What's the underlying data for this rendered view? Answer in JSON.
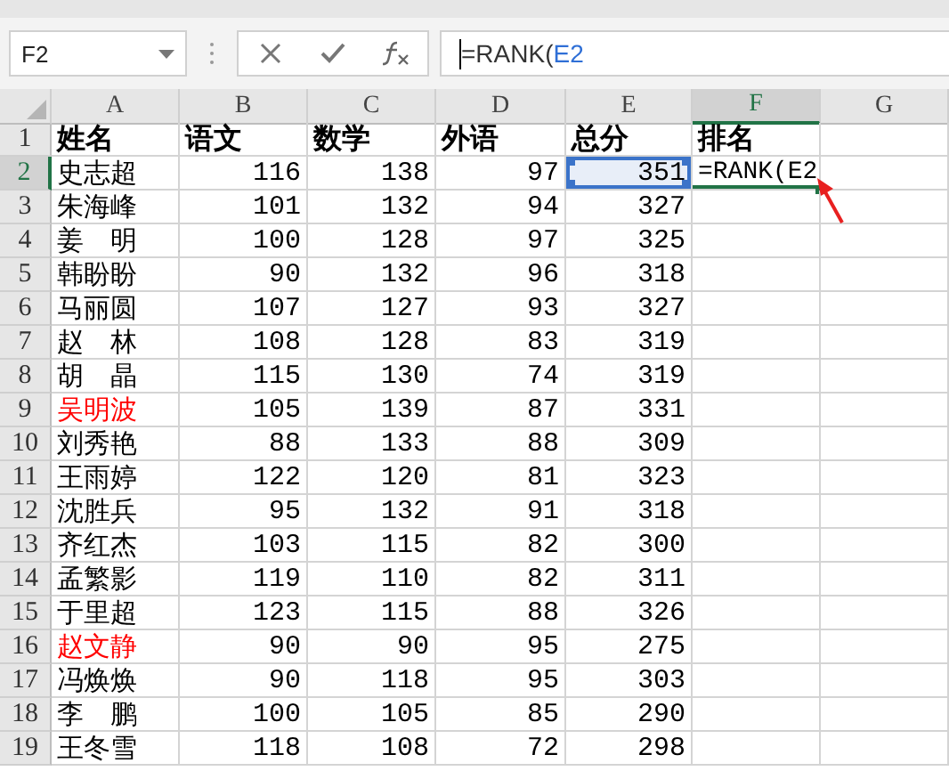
{
  "name_box": "F2",
  "formula": [
    {
      "text": "=RANK(",
      "kind": "plain"
    },
    {
      "text": "E2",
      "kind": "reference"
    }
  ],
  "columns": [
    {
      "label": "A",
      "selected": false
    },
    {
      "label": "B",
      "selected": false
    },
    {
      "label": "C",
      "selected": false
    },
    {
      "label": "D",
      "selected": false
    },
    {
      "label": "E",
      "selected": false
    },
    {
      "label": "F",
      "selected": true
    },
    {
      "label": "G",
      "selected": false
    }
  ],
  "header_row": {
    "number": "1",
    "selected": false,
    "cells": [
      "姓名",
      "语文",
      "数学",
      "外语",
      "总分",
      "排名"
    ]
  },
  "rows": [
    {
      "number": "2",
      "selected": true,
      "name": "史志超",
      "color": "#000000",
      "values": [
        "116",
        "138",
        "97",
        "351"
      ],
      "total_referenced": true,
      "editing": "=RANK(E2"
    },
    {
      "number": "3",
      "selected": false,
      "name": "朱海峰",
      "color": "#000000",
      "values": [
        "101",
        "132",
        "94",
        "327"
      ],
      "total_referenced": false
    },
    {
      "number": "4",
      "selected": false,
      "name": "姜　明",
      "color": "#000000",
      "values": [
        "100",
        "128",
        "97",
        "325"
      ],
      "total_referenced": false
    },
    {
      "number": "5",
      "selected": false,
      "name": "韩盼盼",
      "color": "#000000",
      "values": [
        "90",
        "132",
        "96",
        "318"
      ],
      "total_referenced": false
    },
    {
      "number": "6",
      "selected": false,
      "name": "马丽圆",
      "color": "#000000",
      "values": [
        "107",
        "127",
        "93",
        "327"
      ],
      "total_referenced": false
    },
    {
      "number": "7",
      "selected": false,
      "name": "赵　林",
      "color": "#000000",
      "values": [
        "108",
        "128",
        "83",
        "319"
      ],
      "total_referenced": false
    },
    {
      "number": "8",
      "selected": false,
      "name": "胡　晶",
      "color": "#000000",
      "values": [
        "115",
        "130",
        "74",
        "319"
      ],
      "total_referenced": false
    },
    {
      "number": "9",
      "selected": false,
      "name": "吴明波",
      "color": "#ff0000",
      "values": [
        "105",
        "139",
        "87",
        "331"
      ],
      "total_referenced": false
    },
    {
      "number": "10",
      "selected": false,
      "name": "刘秀艳",
      "color": "#000000",
      "values": [
        "88",
        "133",
        "88",
        "309"
      ],
      "total_referenced": false
    },
    {
      "number": "11",
      "selected": false,
      "name": "王雨婷",
      "color": "#000000",
      "values": [
        "122",
        "120",
        "81",
        "323"
      ],
      "total_referenced": false
    },
    {
      "number": "12",
      "selected": false,
      "name": "沈胜兵",
      "color": "#000000",
      "values": [
        "95",
        "132",
        "91",
        "318"
      ],
      "total_referenced": false
    },
    {
      "number": "13",
      "selected": false,
      "name": "齐红杰",
      "color": "#000000",
      "values": [
        "103",
        "115",
        "82",
        "300"
      ],
      "total_referenced": false
    },
    {
      "number": "14",
      "selected": false,
      "name": "孟繁影",
      "color": "#000000",
      "values": [
        "119",
        "110",
        "82",
        "311"
      ],
      "total_referenced": false
    },
    {
      "number": "15",
      "selected": false,
      "name": "于里超",
      "color": "#000000",
      "values": [
        "123",
        "115",
        "88",
        "326"
      ],
      "total_referenced": false
    },
    {
      "number": "16",
      "selected": false,
      "name": "赵文静",
      "color": "#ff0000",
      "values": [
        "90",
        "90",
        "95",
        "275"
      ],
      "total_referenced": false
    },
    {
      "number": "17",
      "selected": false,
      "name": "冯焕焕",
      "color": "#000000",
      "values": [
        "90",
        "118",
        "95",
        "303"
      ],
      "total_referenced": false
    },
    {
      "number": "18",
      "selected": false,
      "name": "李　鹏",
      "color": "#000000",
      "values": [
        "100",
        "105",
        "85",
        "290"
      ],
      "total_referenced": false
    },
    {
      "number": "19",
      "selected": false,
      "name": "王冬雪",
      "color": "#000000",
      "values": [
        "118",
        "108",
        "72",
        "298"
      ],
      "total_referenced": false
    }
  ]
}
